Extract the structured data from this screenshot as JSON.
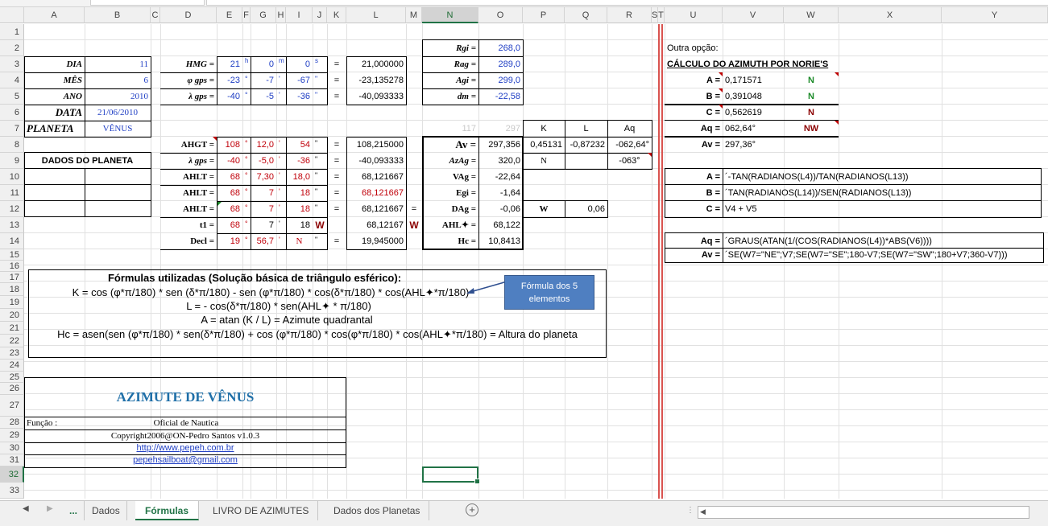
{
  "columns": [
    "A",
    "B",
    "C",
    "D",
    "E",
    "F",
    "G",
    "H",
    "I",
    "J",
    "K",
    "L",
    "M",
    "N",
    "O",
    "P",
    "Q",
    "R",
    "S",
    "T",
    "U",
    "V",
    "W",
    "X",
    "Y"
  ],
  "rows": [
    "1",
    "2",
    "3",
    "4",
    "5",
    "6",
    "7",
    "8",
    "9",
    "10",
    "11",
    "12",
    "13",
    "14",
    "15",
    "16",
    "17",
    "18",
    "19",
    "20",
    "21",
    "22",
    "23",
    "24",
    "25",
    "26",
    "27",
    "28",
    "29",
    "30",
    "31",
    "32",
    "33"
  ],
  "selected": {
    "column": "N",
    "row": "32"
  },
  "date_block": {
    "dia_label": "DIA",
    "dia": "11",
    "mes_label": "MÊS",
    "mes": "6",
    "ano_label": "ANO",
    "ano": "2010",
    "data_label": "DATA",
    "data": "21/06/2010",
    "planeta_label": "PLANETA",
    "planeta": "VÊNUS",
    "dados_planeta": "DADOS DO PLANETA"
  },
  "hmg_block": {
    "hmg": {
      "label": "HMG =",
      "h": "21",
      "hu": "h",
      "m": "0",
      "mu": "m",
      "s": "0",
      "su": "s",
      "eq": "=",
      "result": "21,000000"
    },
    "phi": {
      "label": "φ gps =",
      "d": "-23",
      "m": "-7",
      "s": "-67",
      "eq": "=",
      "result": "-23,135278"
    },
    "lambda": {
      "label": "λ gps =",
      "d": "-40",
      "m": "-5",
      "s": "-36",
      "eq": "=",
      "result": "-40,093333"
    },
    "deg": "°",
    "min": "'",
    "sec": "\""
  },
  "ahg_block": {
    "ahgt": {
      "label": "AHGT =",
      "d": "108",
      "m": "12,0",
      "s": "54",
      "eq": "=",
      "result": "108,215000"
    },
    "lambda": {
      "label": "λ gps =",
      "d": "-40",
      "m": "-5,0",
      "s": "-36",
      "eq": "=",
      "result": "-40,093333"
    },
    "ahlt1": {
      "label": "AHLT =",
      "d": "68",
      "m": "7,30",
      "s": "18,0",
      "eq": "=",
      "result": "68,121667"
    },
    "ahlt2": {
      "label": "AHLT =",
      "d": "68",
      "m": "7",
      "s": "18",
      "eq": "=",
      "result": "68,121667"
    },
    "ahlt3": {
      "label": "AHLT =",
      "d": "68",
      "m": "7",
      "s": "18",
      "eq": "=",
      "result": "68,121667",
      "eq2": "="
    },
    "t1": {
      "label": "t1 =",
      "d": "68",
      "m": "7",
      "s": "18",
      "w": "W",
      "result": "68,12167",
      "w2": "W"
    },
    "decl": {
      "label": "Decl =",
      "d": "19",
      "m": "56,7",
      "s": "N",
      "eq": "=",
      "result": "19,945000"
    }
  },
  "r_block": {
    "rgi": {
      "label": "Rgi =",
      "value": "268,0"
    },
    "rag": {
      "label": "Rag =",
      "value": "289,0"
    },
    "agi": {
      "label": "Agi =",
      "value": "299,0"
    },
    "dm": {
      "label": "dm =",
      "value": "-22,58"
    },
    "faded1": "117",
    "faded2": "297",
    "hdr_k": "K",
    "hdr_l": "L",
    "hdr_aq": "Aq",
    "av": {
      "label": "Av =",
      "value": "297,356",
      "k": "0,45131",
      "l": "-0,87232",
      "aq": "-062,64°"
    },
    "azag": {
      "label": "AzAg =",
      "value": "320,0",
      "k": "N",
      "aq": "-063°"
    },
    "vag": {
      "label": "VAg =",
      "value": "-22,64"
    },
    "egi": {
      "label": "Egi =",
      "value": "-1,64"
    },
    "dag": {
      "label": "DAg =",
      "value": "-0,06",
      "k": "W",
      "l": "0,06"
    },
    "ahl": {
      "label": "AHL✦ =",
      "value": "68,122"
    },
    "hc": {
      "label": "Hc =",
      "value": "10,8413"
    }
  },
  "norie": {
    "outra": "Outra opção:",
    "title": "CÁLCULO DO AZIMUTH POR NORIE'S",
    "a": {
      "label": "A =",
      "value": "0,171571",
      "dir": "N"
    },
    "b": {
      "label": "B =",
      "value": "0,391048",
      "dir": "N"
    },
    "c": {
      "label": "C =",
      "value": "0,562619",
      "dir": "N"
    },
    "aq": {
      "label": "Aq =",
      "value": "062,64°",
      "dir": "NW"
    },
    "av": {
      "label": "Av =",
      "value": "297,36°"
    },
    "fa": {
      "label": "A =",
      "formula": "´-TAN(RADIANOS(L4))/TAN(RADIANOS(L13))"
    },
    "fb": {
      "label": "B =",
      "formula": "´TAN(RADIANOS(L14))/SEN(RADIANOS(L13))"
    },
    "fc": {
      "label": "C =",
      "formula": "V4 + V5"
    },
    "faq": {
      "label": "Aq =",
      "formula": "´GRAUS(ATAN(1/(COS(RADIANOS(L4))*ABS(V6))))"
    },
    "fav": {
      "label": "Av =",
      "formula": "´SE(W7=\"NE\";V7;SE(W7=\"SE\";180-V7;SE(W7=\"SW\";180+V7;360-V7)))"
    }
  },
  "formulas": {
    "title": "Fórmulas utilizadas (Solução básica de triângulo esférico):",
    "f1": "K = cos (φ*π/180)  * sen (δ*π/180)  - sen (φ*π/180)  * cos(δ*π/180) * cos(AHL✦*π/180)",
    "f2": "L = - cos(δ*π/180)  * sen(AHL✦  * π/180)",
    "f3": "A = atan (K / L) = Azimute  quadrantal",
    "f4": "Hc  = asen(sen (φ*π/180)  * sen(δ*π/180)  + cos (φ*π/180)  * cos(φ*π/180)  * cos(AHL✦*π/180)  = Altura do planeta",
    "callout": "Fórmula dos 5 elementos"
  },
  "title_box": {
    "title": "AZIMUTE DE VÊNUS",
    "funcao_label": "Função :",
    "funcao": "Oficial de Nautica",
    "copyright": "Copyright2006@ON-Pedro Santos   v1.0.3",
    "url": "http://www.pepeh.com.br",
    "email": "pepehsailboat@gmail.com"
  },
  "tabs": {
    "ellipsis": "...",
    "t1": "Dados",
    "t2": "Fórmulas",
    "t3": "LIVRO DE AZIMUTES",
    "t4": "Dados dos Planetas"
  },
  "colors": {
    "accent": "#217346",
    "blue_value": "#1f3ec4",
    "red_value": "#c0000a",
    "green_value": "#1b8a28"
  }
}
